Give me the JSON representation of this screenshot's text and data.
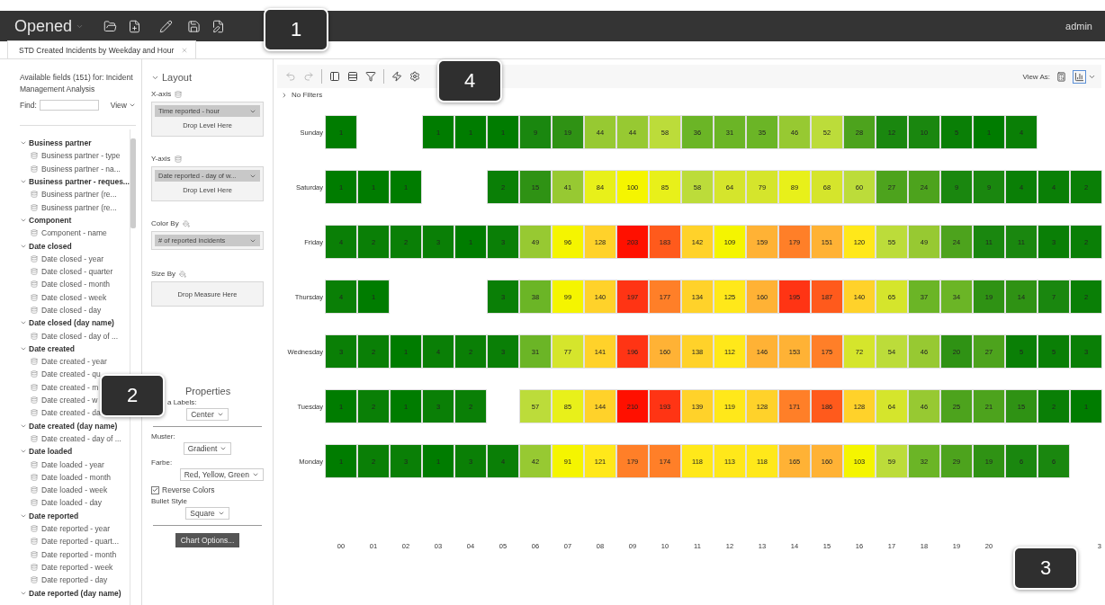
{
  "top_bar": {
    "title": "Opened",
    "user": "admin"
  },
  "tabs": [
    {
      "label": "STD Created Incidents by Weekday and Hour",
      "selected": true
    }
  ],
  "fields_panel": {
    "heading": "Available fields (151) for: Incident Management Analysis",
    "find_label": "Find:",
    "view_label": "View",
    "groups": [
      {
        "label": "Business partner",
        "expanded": true,
        "children": [
          {
            "label": "Business partner - type"
          },
          {
            "label": "Business partner - na..."
          }
        ]
      },
      {
        "label": "Business partner - reques...",
        "expanded": true,
        "children": [
          {
            "label": "Business partner (re..."
          },
          {
            "label": "Business partner (re..."
          }
        ]
      },
      {
        "label": "Component",
        "expanded": true,
        "children": [
          {
            "label": "Component - name"
          }
        ]
      },
      {
        "label": "Date closed",
        "expanded": true,
        "children": [
          {
            "label": "Date closed - year"
          },
          {
            "label": "Date closed - quarter"
          },
          {
            "label": "Date closed - month"
          },
          {
            "label": "Date closed - week"
          },
          {
            "label": "Date closed - day"
          }
        ]
      },
      {
        "label": "Date closed (day name)",
        "expanded": true,
        "children": [
          {
            "label": "Date closed - day of ..."
          }
        ]
      },
      {
        "label": "Date created",
        "expanded": true,
        "children": [
          {
            "label": "Date created - year"
          },
          {
            "label": "Date created - qu"
          },
          {
            "label": "Date created - m"
          },
          {
            "label": "Date created - w"
          },
          {
            "label": "Date created - da"
          }
        ]
      },
      {
        "label": "Date created (day name)",
        "expanded": true,
        "children": [
          {
            "label": "Date created - day of ..."
          }
        ]
      },
      {
        "label": "Date loaded",
        "expanded": true,
        "children": [
          {
            "label": "Date loaded - year"
          },
          {
            "label": "Date loaded - month"
          },
          {
            "label": "Date loaded - week"
          },
          {
            "label": "Date loaded - day"
          }
        ]
      },
      {
        "label": "Date reported",
        "expanded": true,
        "children": [
          {
            "label": "Date reported - year"
          },
          {
            "label": "Date reported - quart..."
          },
          {
            "label": "Date reported - month"
          },
          {
            "label": "Date reported - week"
          },
          {
            "label": "Date reported - day"
          }
        ]
      },
      {
        "label": "Date reported (day name)",
        "expanded": true
      }
    ]
  },
  "layout_panel": {
    "heading": "Layout",
    "expanded": true,
    "x_axis": {
      "label": "X-axis",
      "pill": "Time reported - hour",
      "drop": "Drop Level Here"
    },
    "y_axis": {
      "label": "Y-axis",
      "pill": "Date reported - day of w...",
      "drop": "Drop Level Here"
    },
    "color_by": {
      "label": "Color By",
      "pill": "# of reported incidents"
    },
    "size_by": {
      "label": "Size By",
      "drop": "Drop Measure Here"
    }
  },
  "properties": {
    "heading": "Properties",
    "data_labels": {
      "label": "a Labels:",
      "value": "Center"
    },
    "muster": {
      "label": "Muster:",
      "value": "Gradient"
    },
    "farbe": {
      "label": "Farbe:",
      "value": "Red, Yellow, Green"
    },
    "reverse_colors": {
      "label": "Reverse Colors",
      "checked": true
    },
    "bullet_style": {
      "label": "Bullet Style",
      "value": "Square"
    },
    "chart_options": "Chart Options..."
  },
  "chart_toolbar": {
    "view_as": "View As:",
    "views": [
      {
        "kind": "table",
        "selected": false
      },
      {
        "kind": "chart",
        "selected": true
      }
    ],
    "filters": "No Filters"
  },
  "heatmap": {
    "rows": [
      {
        "label": "Sunday",
        "cells": [
          {
            "text": "1",
            "color": "#007c00"
          },
          null,
          null,
          {
            "text": "1",
            "color": "#007c00"
          },
          {
            "text": "1",
            "color": "#007c00"
          },
          {
            "text": "1",
            "color": "#007c00"
          },
          {
            "text": "9",
            "color": "#1a870f"
          },
          {
            "text": "19",
            "color": "#2f9214"
          },
          {
            "text": "44",
            "color": "#97c932"
          },
          {
            "text": "44",
            "color": "#97c932"
          },
          {
            "text": "58",
            "color": "#bcdc3a"
          },
          {
            "text": "36",
            "color": "#6bb526"
          },
          {
            "text": "31",
            "color": "#6bb526"
          },
          {
            "text": "35",
            "color": "#6bb526"
          },
          {
            "text": "46",
            "color": "#97c932"
          },
          {
            "text": "52",
            "color": "#bcdc3a"
          },
          {
            "text": "28",
            "color": "#4da31d"
          },
          {
            "text": "12",
            "color": "#1a870f"
          },
          {
            "text": "10",
            "color": "#1a870f"
          },
          {
            "text": "5",
            "color": "#0a7f06"
          },
          {
            "text": "1",
            "color": "#007c00"
          },
          {
            "text": "4",
            "color": "#0a7f06"
          },
          null,
          null
        ]
      },
      {
        "label": "Saturday",
        "cells": [
          {
            "text": "1",
            "color": "#007c00"
          },
          {
            "text": "1",
            "color": "#007c00"
          },
          {
            "text": "1",
            "color": "#007c00"
          },
          null,
          null,
          {
            "text": "2",
            "color": "#0a7f06"
          },
          {
            "text": "15",
            "color": "#2f9214"
          },
          {
            "text": "41",
            "color": "#97c932"
          },
          {
            "text": "84",
            "color": "#e8f01a"
          },
          {
            "text": "100",
            "color": "#f5f500"
          },
          {
            "text": "85",
            "color": "#e8f01a"
          },
          {
            "text": "58",
            "color": "#bcdc3a"
          },
          {
            "text": "64",
            "color": "#d5e52c"
          },
          {
            "text": "79",
            "color": "#d5e52c"
          },
          {
            "text": "89",
            "color": "#e8f01a"
          },
          {
            "text": "68",
            "color": "#d5e52c"
          },
          {
            "text": "60",
            "color": "#bcdc3a"
          },
          {
            "text": "27",
            "color": "#4da31d"
          },
          {
            "text": "24",
            "color": "#4da31d"
          },
          {
            "text": "9",
            "color": "#1a870f"
          },
          {
            "text": "9",
            "color": "#1a870f"
          },
          {
            "text": "4",
            "color": "#0a7f06"
          },
          {
            "text": "4",
            "color": "#0a7f06"
          },
          {
            "text": "2",
            "color": "#0a7f06"
          }
        ]
      },
      {
        "label": "Friday",
        "cells": [
          {
            "text": "4",
            "color": "#0a7f06"
          },
          {
            "text": "2",
            "color": "#0a7f06"
          },
          {
            "text": "2",
            "color": "#0a7f06"
          },
          {
            "text": "3",
            "color": "#0a7f06"
          },
          {
            "text": "1",
            "color": "#007c00"
          },
          {
            "text": "3",
            "color": "#0a7f06"
          },
          {
            "text": "49",
            "color": "#97c932"
          },
          {
            "text": "96",
            "color": "#f5f500"
          },
          {
            "text": "128",
            "color": "#ffd22a"
          },
          {
            "text": "203",
            "color": "#ff1000"
          },
          {
            "text": "183",
            "color": "#ff5a1c"
          },
          {
            "text": "142",
            "color": "#ffd22a"
          },
          {
            "text": "109",
            "color": "#f5f500"
          },
          {
            "text": "159",
            "color": "#ffb235"
          },
          {
            "text": "179",
            "color": "#ff7f28"
          },
          {
            "text": "151",
            "color": "#ffb235"
          },
          {
            "text": "120",
            "color": "#ffe81a"
          },
          {
            "text": "55",
            "color": "#bcdc3a"
          },
          {
            "text": "49",
            "color": "#97c932"
          },
          {
            "text": "24",
            "color": "#4da31d"
          },
          {
            "text": "11",
            "color": "#1a870f"
          },
          {
            "text": "11",
            "color": "#1a870f"
          },
          {
            "text": "3",
            "color": "#0a7f06"
          },
          {
            "text": "2",
            "color": "#0a7f06"
          }
        ]
      },
      {
        "label": "Thursday",
        "cells": [
          {
            "text": "4",
            "color": "#0a7f06"
          },
          {
            "text": "1",
            "color": "#007c00"
          },
          null,
          null,
          null,
          {
            "text": "3",
            "color": "#0a7f06"
          },
          {
            "text": "38",
            "color": "#6bb526"
          },
          {
            "text": "99",
            "color": "#f5f500"
          },
          {
            "text": "140",
            "color": "#ffd22a"
          },
          {
            "text": "197",
            "color": "#ff3414"
          },
          {
            "text": "177",
            "color": "#ff7f28"
          },
          {
            "text": "134",
            "color": "#ffd22a"
          },
          {
            "text": "125",
            "color": "#ffe81a"
          },
          {
            "text": "160",
            "color": "#ffb235"
          },
          {
            "text": "195",
            "color": "#ff3414"
          },
          {
            "text": "187",
            "color": "#ff5a1c"
          },
          {
            "text": "140",
            "color": "#ffd22a"
          },
          {
            "text": "65",
            "color": "#d5e52c"
          },
          {
            "text": "37",
            "color": "#6bb526"
          },
          {
            "text": "34",
            "color": "#6bb526"
          },
          {
            "text": "19",
            "color": "#2f9214"
          },
          {
            "text": "14",
            "color": "#2f9214"
          },
          {
            "text": "7",
            "color": "#1a870f"
          },
          {
            "text": "2",
            "color": "#0a7f06"
          }
        ]
      },
      {
        "label": "Wednesday",
        "cells": [
          {
            "text": "3",
            "color": "#0a7f06"
          },
          {
            "text": "2",
            "color": "#0a7f06"
          },
          {
            "text": "1",
            "color": "#007c00"
          },
          {
            "text": "4",
            "color": "#0a7f06"
          },
          {
            "text": "2",
            "color": "#0a7f06"
          },
          {
            "text": "3",
            "color": "#0a7f06"
          },
          {
            "text": "31",
            "color": "#6bb526"
          },
          {
            "text": "77",
            "color": "#d5e52c"
          },
          {
            "text": "141",
            "color": "#ffd22a"
          },
          {
            "text": "196",
            "color": "#ff3414"
          },
          {
            "text": "160",
            "color": "#ffb235"
          },
          {
            "text": "138",
            "color": "#ffd22a"
          },
          {
            "text": "112",
            "color": "#ffe81a"
          },
          {
            "text": "146",
            "color": "#ffb235"
          },
          {
            "text": "153",
            "color": "#ffb235"
          },
          {
            "text": "175",
            "color": "#ff7f28"
          },
          {
            "text": "72",
            "color": "#d5e52c"
          },
          {
            "text": "54",
            "color": "#bcdc3a"
          },
          {
            "text": "46",
            "color": "#97c932"
          },
          {
            "text": "20",
            "color": "#2f9214"
          },
          {
            "text": "27",
            "color": "#4da31d"
          },
          {
            "text": "5",
            "color": "#0a7f06"
          },
          {
            "text": "5",
            "color": "#0a7f06"
          },
          {
            "text": "3",
            "color": "#0a7f06"
          }
        ]
      },
      {
        "label": "Tuesday",
        "cells": [
          {
            "text": "1",
            "color": "#007c00"
          },
          {
            "text": "2",
            "color": "#0a7f06"
          },
          {
            "text": "1",
            "color": "#007c00"
          },
          {
            "text": "3",
            "color": "#0a7f06"
          },
          {
            "text": "2",
            "color": "#0a7f06"
          },
          null,
          {
            "text": "57",
            "color": "#bcdc3a"
          },
          {
            "text": "85",
            "color": "#e8f01a"
          },
          {
            "text": "144",
            "color": "#ffd22a"
          },
          {
            "text": "210",
            "color": "#ff1000"
          },
          {
            "text": "193",
            "color": "#ff3414"
          },
          {
            "text": "139",
            "color": "#ffd22a"
          },
          {
            "text": "119",
            "color": "#ffe81a"
          },
          {
            "text": "128",
            "color": "#ffd22a"
          },
          {
            "text": "171",
            "color": "#ff7f28"
          },
          {
            "text": "186",
            "color": "#ff5a1c"
          },
          {
            "text": "128",
            "color": "#ffd22a"
          },
          {
            "text": "64",
            "color": "#d5e52c"
          },
          {
            "text": "46",
            "color": "#97c932"
          },
          {
            "text": "25",
            "color": "#4da31d"
          },
          {
            "text": "21",
            "color": "#4da31d"
          },
          {
            "text": "15",
            "color": "#2f9214"
          },
          {
            "text": "2",
            "color": "#0a7f06"
          },
          {
            "text": "1",
            "color": "#007c00"
          }
        ]
      },
      {
        "label": "Monday",
        "cells": [
          {
            "text": "1",
            "color": "#007c00"
          },
          {
            "text": "2",
            "color": "#0a7f06"
          },
          {
            "text": "3",
            "color": "#0a7f06"
          },
          {
            "text": "1",
            "color": "#007c00"
          },
          {
            "text": "3",
            "color": "#0a7f06"
          },
          {
            "text": "4",
            "color": "#0a7f06"
          },
          {
            "text": "42",
            "color": "#97c932"
          },
          {
            "text": "91",
            "color": "#f5f500"
          },
          {
            "text": "121",
            "color": "#ffe81a"
          },
          {
            "text": "179",
            "color": "#ff7f28"
          },
          {
            "text": "174",
            "color": "#ff7f28"
          },
          {
            "text": "118",
            "color": "#ffe81a"
          },
          {
            "text": "113",
            "color": "#ffe81a"
          },
          {
            "text": "118",
            "color": "#ffe81a"
          },
          {
            "text": "165",
            "color": "#ffb235"
          },
          {
            "text": "160",
            "color": "#ffb235"
          },
          {
            "text": "103",
            "color": "#f5f500"
          },
          {
            "text": "59",
            "color": "#bcdc3a"
          },
          {
            "text": "32",
            "color": "#6bb526"
          },
          {
            "text": "29",
            "color": "#4da31d"
          },
          {
            "text": "19",
            "color": "#2f9214"
          },
          {
            "text": "6",
            "color": "#1a870f"
          },
          {
            "text": "6",
            "color": "#1a870f"
          },
          null
        ]
      }
    ],
    "x_labels": [
      "00",
      "01",
      "02",
      "03",
      "04",
      "05",
      "06",
      "07",
      "08",
      "09",
      "10",
      "11",
      "12",
      "13",
      "14",
      "15",
      "16",
      "17",
      "18",
      "19",
      "20"
    ],
    "x_label_end": "3"
  },
  "callouts": [
    {
      "label": "1"
    },
    {
      "label": "2"
    },
    {
      "label": "3"
    },
    {
      "label": "4"
    }
  ]
}
